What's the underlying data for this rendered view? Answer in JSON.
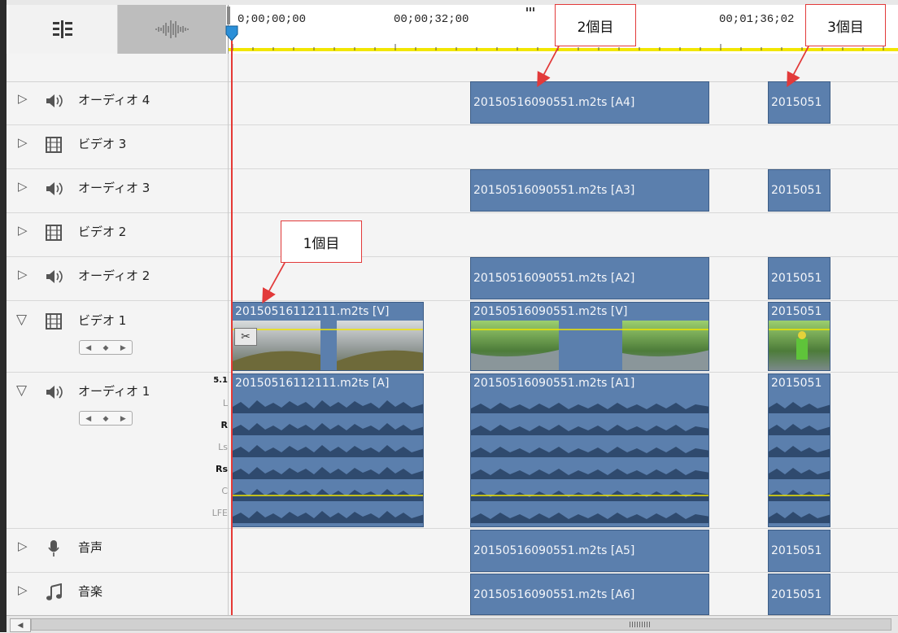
{
  "ruler": {
    "timecodes": [
      "0;00;00;00",
      "00;00;32;00",
      "00;01;36;02"
    ]
  },
  "tracks": [
    {
      "name": "オーディオ 4",
      "icon": "speaker-icon",
      "expanded": false
    },
    {
      "name": "ビデオ 3",
      "icon": "film-icon",
      "expanded": false
    },
    {
      "name": "オーディオ 3",
      "icon": "speaker-icon",
      "expanded": false
    },
    {
      "name": "ビデオ 2",
      "icon": "film-icon",
      "expanded": false
    },
    {
      "name": "オーディオ 2",
      "icon": "speaker-icon",
      "expanded": false
    },
    {
      "name": "ビデオ 1",
      "icon": "film-icon",
      "expanded": true
    },
    {
      "name": "オーディオ 1",
      "icon": "speaker-icon",
      "expanded": true
    },
    {
      "name": "音声",
      "icon": "microphone-icon",
      "expanded": false
    },
    {
      "name": "音楽",
      "icon": "music-note-icon",
      "expanded": false
    }
  ],
  "channels": {
    "format": "5.1",
    "labels": [
      "L",
      "R",
      "Ls",
      "Rs",
      "C",
      "LFE"
    ]
  },
  "clips": {
    "a4_2": "20150516090551.m2ts [A4]",
    "a4_3": "2015051",
    "a3_2": "20150516090551.m2ts [A3]",
    "a3_3": "2015051",
    "a2_2": "20150516090551.m2ts [A2]",
    "a2_3": "2015051",
    "v1_1": "20150516112111.m2ts [V]",
    "v1_2": "20150516090551.m2ts [V]",
    "v1_3": "2015051",
    "a1_1": "20150516112111.m2ts [A]",
    "a1_2": "20150516090551.m2ts [A1]",
    "a1_3": "2015051",
    "voice_2": "20150516090551.m2ts [A5]",
    "voice_3": "2015051",
    "music_2": "20150516090551.m2ts [A6]",
    "music_3": "2015051"
  },
  "annotations": {
    "first": "1個目",
    "second": "2個目",
    "third": "3個目"
  },
  "colors": {
    "clip": "#5b7fad",
    "playhead": "#e53935",
    "annotation_border": "#e23a3a",
    "guide_line": "#f2e600"
  }
}
